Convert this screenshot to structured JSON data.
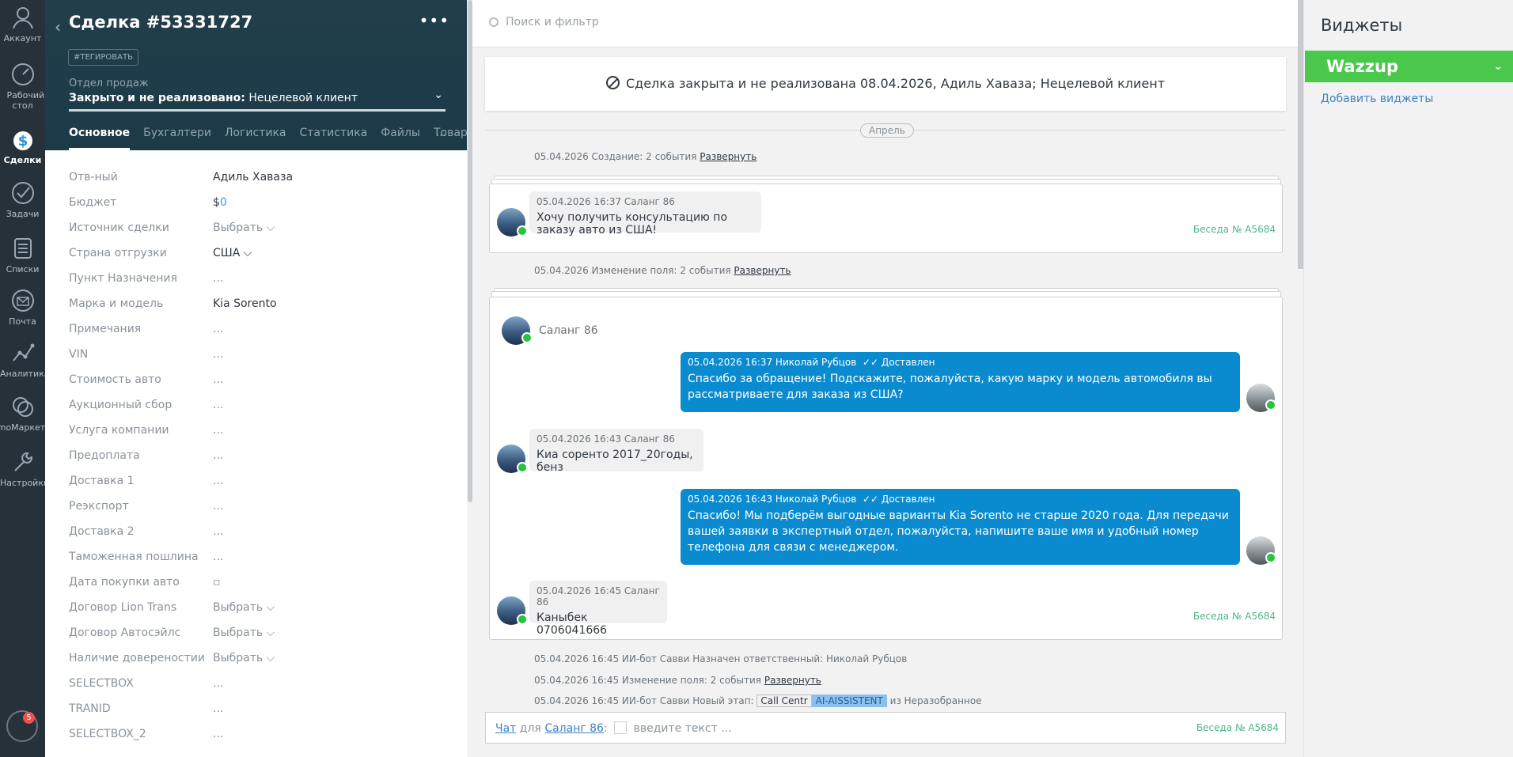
{
  "nav": {
    "items": [
      {
        "label": "Аккаунт",
        "icon": "user-icon"
      },
      {
        "label": "Рабочий стол",
        "icon": "speedometer-icon"
      },
      {
        "label": "Сделки",
        "icon": "dollar-icon"
      },
      {
        "label": "Задачи",
        "icon": "checkmark-icon"
      },
      {
        "label": "Списки",
        "icon": "list-icon"
      },
      {
        "label": "Почта",
        "icon": "mail-icon"
      },
      {
        "label": "Аналитика",
        "icon": "chart-icon"
      },
      {
        "label": "amoМаркет",
        "icon": "market-icon"
      },
      {
        "label": "Настройки",
        "icon": "wrench-icon"
      }
    ],
    "notifications_count": "5"
  },
  "card": {
    "title": "Сделка #53331727",
    "tag_button": "#ТЕГИРОВАТЬ",
    "pipeline_label": "Отдел продаж",
    "status_bold": "Закрыто и не реализовано:",
    "status_reason": " Нецелевой клиент",
    "tabs": [
      "Основное",
      "Бухгалтери",
      "Логистика",
      "Статистика",
      "Файлы",
      "Товары"
    ],
    "tabs_more": "...",
    "fields": [
      {
        "label": "Отв-ный",
        "value": "Адиль Хаваза"
      },
      {
        "label": "Бюджет",
        "value": "$",
        "value_extra": "0"
      },
      {
        "label": "Источник сделки",
        "value": "Выбрать ⌵"
      },
      {
        "label": "Страна отгрузки",
        "value": "США ⌵"
      },
      {
        "label": "Пункт Назначения",
        "value": "..."
      },
      {
        "label": "Марка и модель",
        "value": "Kia Sorento"
      },
      {
        "label": "Примечания",
        "value": "..."
      },
      {
        "label": "VIN",
        "value": "..."
      },
      {
        "label": "Стоимость авто",
        "value": "..."
      },
      {
        "label": "Аукционный сбор",
        "value": "..."
      },
      {
        "label": "Услуга компании",
        "value": "..."
      },
      {
        "label": "Предоплата",
        "value": "..."
      },
      {
        "label": "Доставка 1",
        "value": "..."
      },
      {
        "label": "Реэкспорт",
        "value": "..."
      },
      {
        "label": "Доставка 2",
        "value": "..."
      },
      {
        "label": "Таможенная пошлина",
        "value": "..."
      },
      {
        "label": "Дата покупки авто",
        "value": "▫"
      },
      {
        "label": "Договор Lion Trans",
        "value": "Выбрать ⌵"
      },
      {
        "label": "Договор Автосэйлс",
        "value": "Выбрать ⌵"
      },
      {
        "label": "Наличие довереностии",
        "value": "Выбрать ⌵"
      },
      {
        "label": "SELECTBOX",
        "value": "..."
      },
      {
        "label": "TRANID",
        "value": "..."
      },
      {
        "label": "SELECTBOX_2",
        "value": "..."
      }
    ]
  },
  "feed": {
    "search_placeholder": "Поиск и фильтр",
    "closed_banner": "Сделка закрыта и не реализована 08.04.2026, Адиль Хаваза; Нецелевой клиент",
    "month": "Апрель",
    "sys1": "05.04.2026 Создание: 2 события",
    "expand": "Развернуть",
    "msg1_meta": "05.04.2026 16:37 Саланг 86",
    "msg1_text": "Хочу получить консультацию по заказу авто из США!",
    "conv_label": "Беседа № A5684",
    "sys2": "05.04.2026 Изменение поля: 2 события",
    "contact_name": "Саланг 86",
    "out1_meta": "05.04.2026 16:37 Николай Рубцов",
    "delivered": "✓✓ Доставлен",
    "out1_text": "Спасибо за обращение! Подскажите, пожалуйста, какую марку и модель автомобиля вы рассматриваете для заказа из США?",
    "in2_meta": "05.04.2026 16:43 Саланг 86",
    "in2_text": "Киа соренто 2017_20годы, бенз",
    "out2_meta": "05.04.2026 16:43 Николай Рубцов",
    "out2_text": "Спасибо! Мы подберём выгодные варианты Kia Sorento не старше 2020 года. Для передачи вашей заявки в экспертный отдел, пожалуйста, напишите ваше имя и удобный номер телефона для связи с менеджером.",
    "in3_meta": "05.04.2026 16:45 Саланг 86",
    "in3_text": "Каныбек 0706041666",
    "sys3": "05.04.2026 16:45 ИИ-бот Савви Назначен ответственный: Николай Рубцов",
    "sys4": "05.04.2026 16:45 Изменение поля: 2 события",
    "sys5_prefix": "05.04.2026 16:45 ИИ-бот Савви Новый этап:",
    "stage_from": "Call Centr",
    "stage_to": "AI-AISSISTENT",
    "sys5_suffix": "из Неразобранное",
    "chat_link": "Чат",
    "chat_for": "для",
    "chat_contact": "Саланг 86",
    "chat_placeholder": "введите текст ..."
  },
  "widgets": {
    "title": "Виджеты",
    "wazzup": "Wazzup",
    "add": "Добавить виджеты"
  }
}
